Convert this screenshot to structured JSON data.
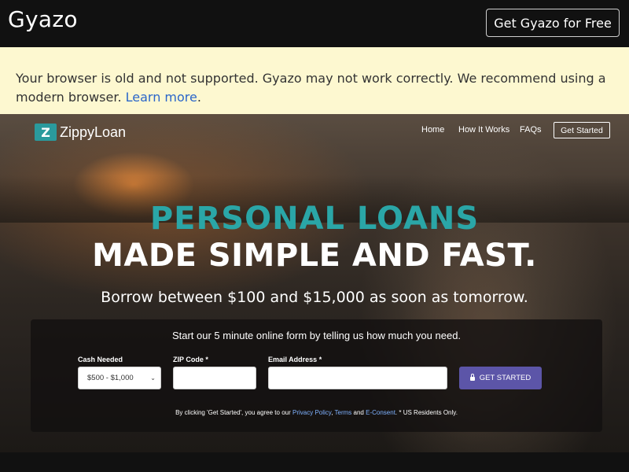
{
  "gyazo": {
    "logo": "Gyazo",
    "cta": "Get Gyazo for Free",
    "notice_text": "Your browser is old and not supported. Gyazo may not work correctly. We recommend using a modern browser.",
    "notice_link": "Learn more",
    "notice_period": "."
  },
  "site": {
    "logo_mark": "Z",
    "logo_name": "ZippyLoan",
    "nav": {
      "home": "Home",
      "how_it_works": "How It Works",
      "faqs": "FAQs",
      "get_started": "Get Started"
    },
    "hero": {
      "line1": "PERSONAL LOANS",
      "line2": "MADE SIMPLE AND FAST.",
      "subtitle": "Borrow between $100 and $15,000 as soon as tomorrow."
    },
    "form": {
      "title": "Start our 5 minute online form by telling us how much you need.",
      "cash_label": "Cash Needed",
      "cash_value": "$500 - $1,000",
      "zip_label": "ZIP Code *",
      "zip_value": "",
      "email_label": "Email Address *",
      "email_value": "",
      "submit": "GET STARTED",
      "terms_prefix": "By clicking 'Get Started', you agree to our",
      "privacy": "Privacy Policy",
      "comma": ",",
      "terms": "Terms",
      "and": "and",
      "econsent": "E-Consent",
      "terms_suffix": ". * US Residents Only."
    }
  }
}
